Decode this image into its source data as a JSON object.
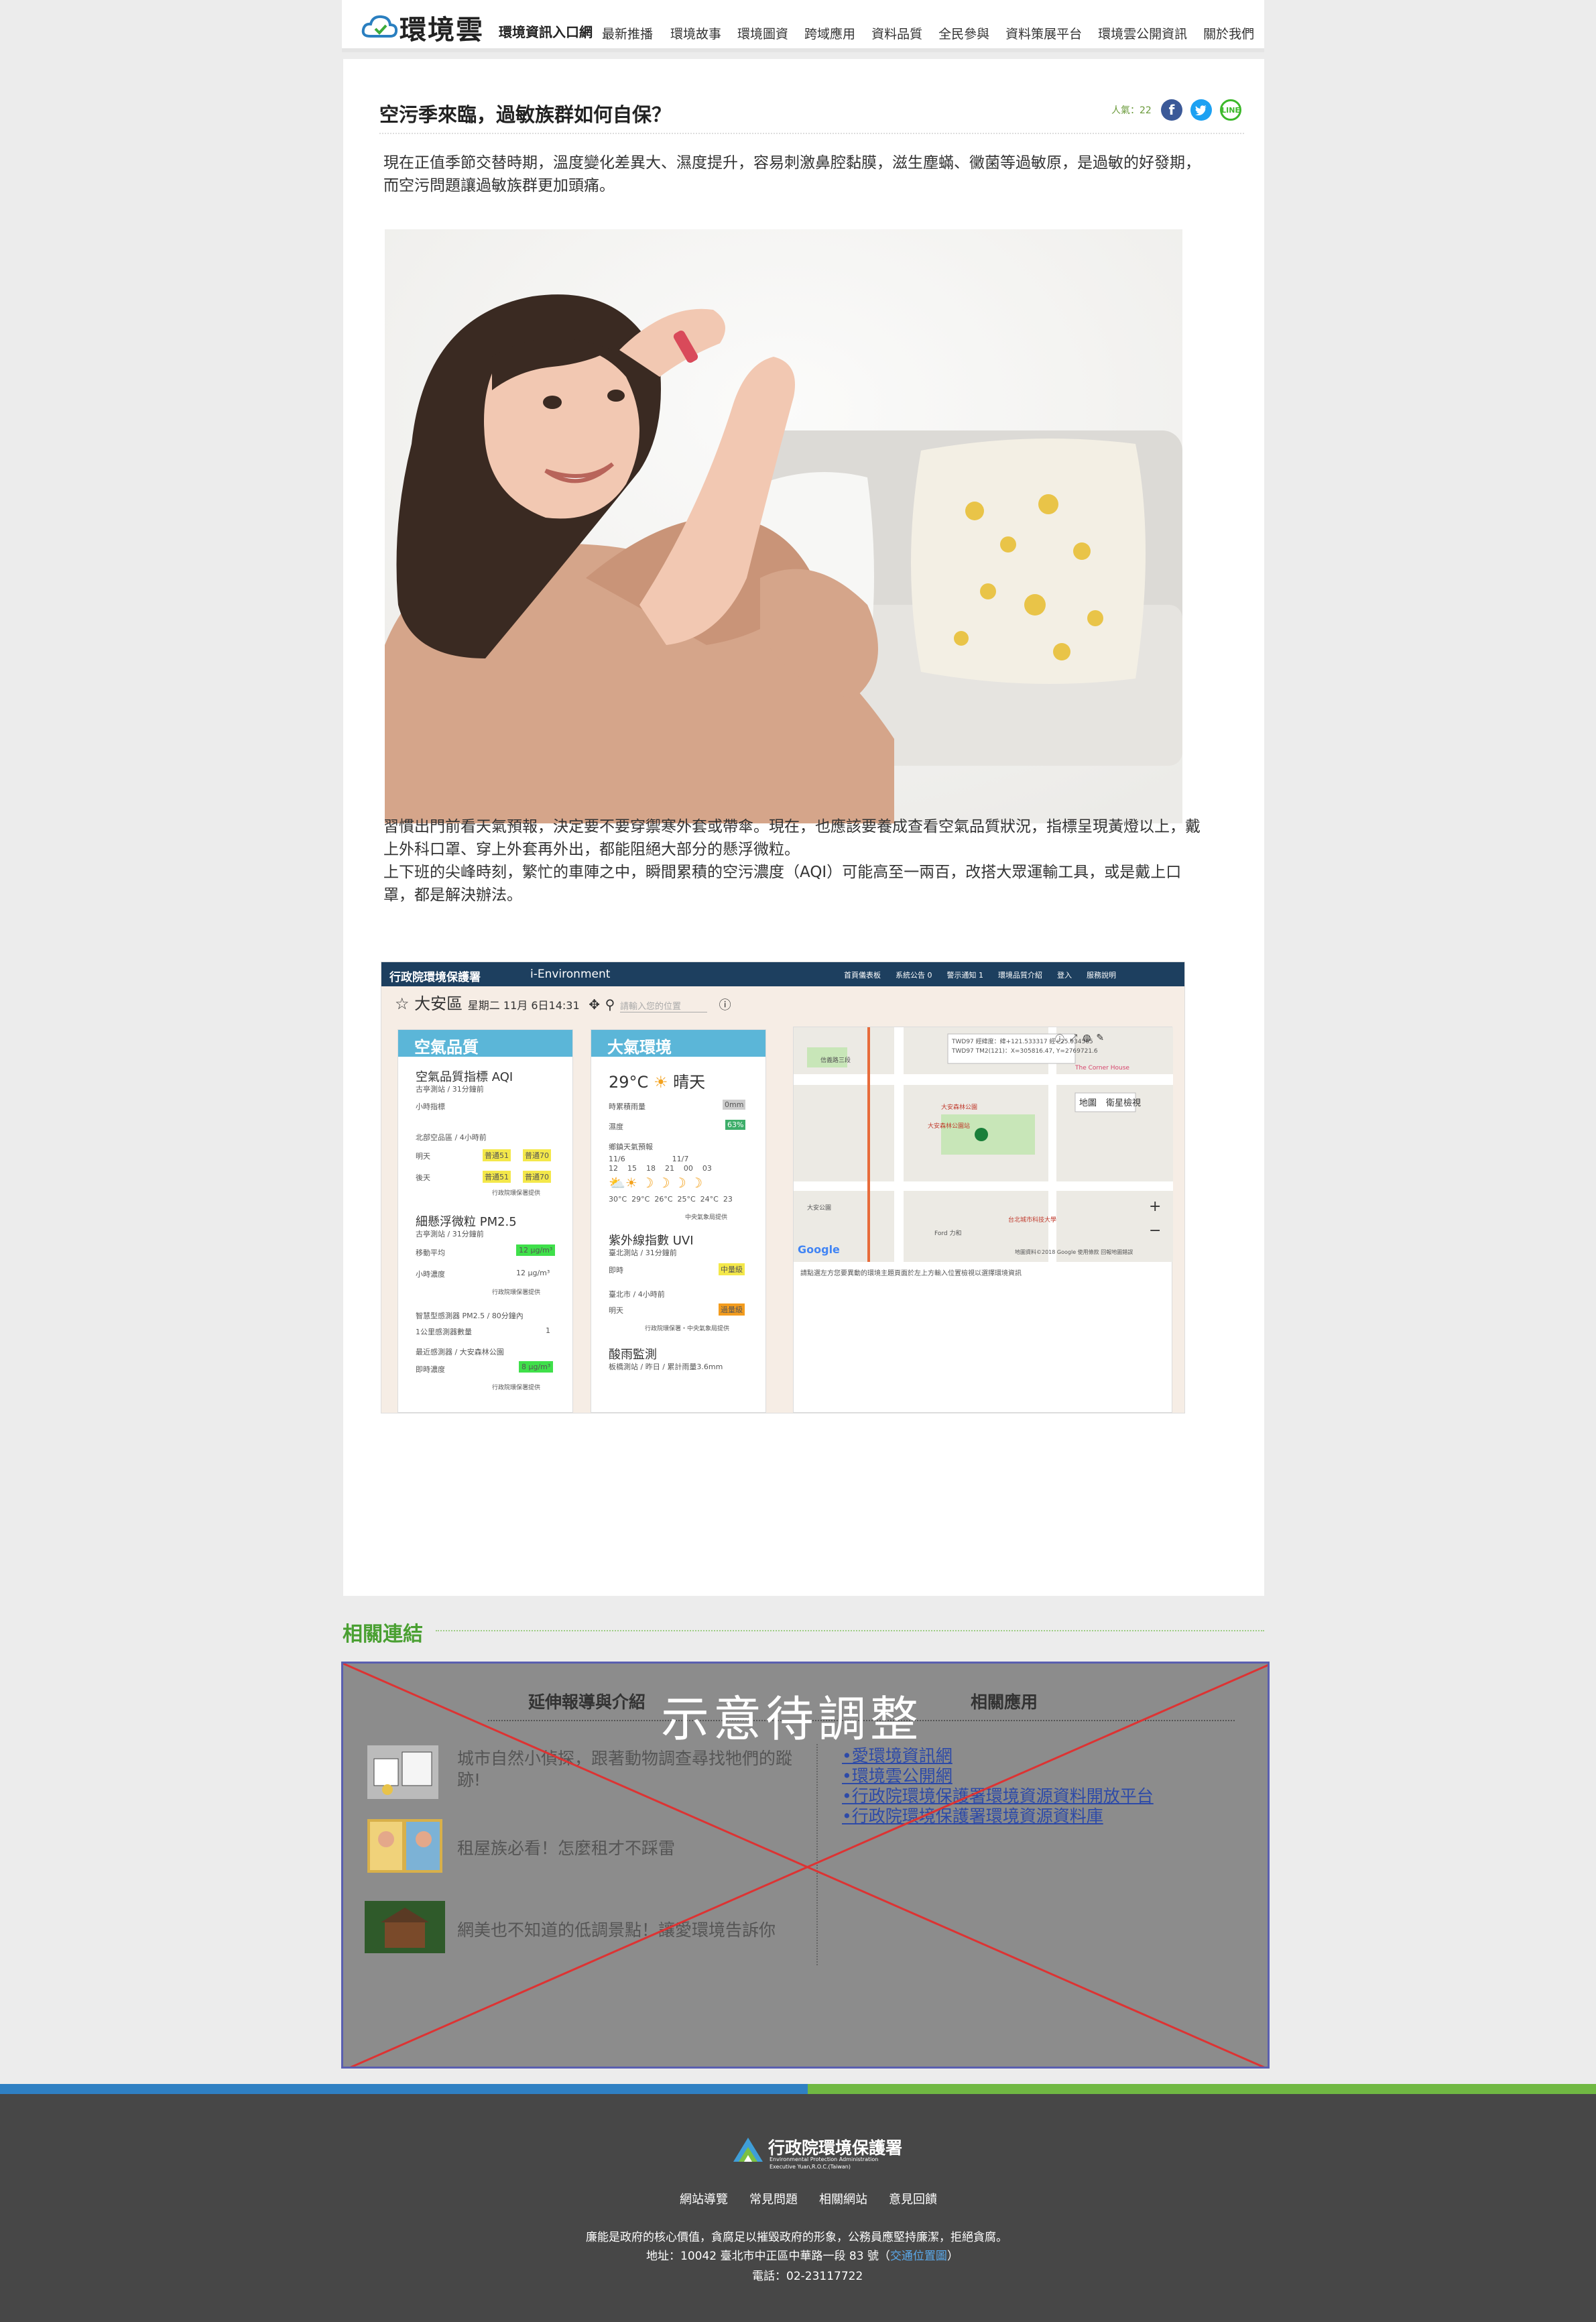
{
  "header": {
    "logo_text": "環境雲",
    "logo_subtitle": "環境資訊入口網",
    "nav": [
      "最新推播",
      "環境故事",
      "環境圖資",
      "跨域應用",
      "資料品質",
      "全民參與",
      "資料策展平台",
      "環境雲公開資訊",
      "關於我們"
    ]
  },
  "article": {
    "title": "空污季來臨，過敏族群如何自保？",
    "views": "人氣：22",
    "intro": "現在正值季節交替時期，溫度變化差異大、濕度提升，容易刺激鼻腔黏膜，滋生塵蟎、黴菌等過敏原，是過敏的好發期，而空污問題讓過敏族群更加頭痛。",
    "body1": "習慣出門前看天氣預報，決定要不要穿禦寒外套或帶傘。現在，也應該要養成查看空氣品質狀況，指標呈現黃燈以上，戴上外科口罩、穿上外套再外出，都能阻絕大部分的懸浮微粒。",
    "body2": "上下班的尖峰時刻，繁忙的車陣之中，瞬間累積的空污濃度（AQI）可能高至一兩百，改搭大眾運輸工具，或是戴上口罩，都是解決辦法。"
  },
  "screenshot": {
    "agency": "行政院環境保護署",
    "app": "i-Environment",
    "menu": [
      "首頁儀表板",
      "系統公告 0",
      "警示通知 1",
      "環境品質介紹",
      "登入",
      "服務說明"
    ],
    "location": "大安區",
    "date": "星期二 11月 6日14:31",
    "search_placeholder": "請輸入您的位置",
    "air_card": {
      "title": "空氣品質",
      "aqi_label": "空氣品質指標 AQI",
      "aqi_note": "古亭測站 / 31分鐘前",
      "hourly": "小時指標",
      "forecast_label": "北部空品區 / 4小時前",
      "tomorrow": "明天",
      "after": "後天",
      "badge1": "普通51",
      "badge2": "普通70",
      "source": "行政院環保署提供",
      "pm_label": "細懸浮微粒 PM2.5",
      "pm_note": "古亭測站 / 31分鐘前",
      "moving": "移動平均",
      "pm_val": "12 μg/m³",
      "hourly_conc": "小時濃度",
      "hourly_val": "12 μg/m³",
      "sensor": "智慧型感測器 PM2.5 / 80分鐘內",
      "sensor_count": "1公里感測器數量",
      "sensor_count_val": "1",
      "nearest": "最近感測器 / 大安森林公園",
      "nearest_label": "即時濃度",
      "nearest_val": "8 μg/m³"
    },
    "weather_card": {
      "title": "大氣環境",
      "temp": "29°C",
      "cond": "晴天",
      "rain": "時累積雨量",
      "rain_val": "0mm",
      "humidity": "濕度",
      "humidity_val": "63%",
      "forecast": "鄉鎮天氣預報",
      "dates": "11/6                    11/7",
      "hours": "12    15    18    21    00    03",
      "temps": "30°C  29°C  26°C  25°C  24°C  23",
      "source": "中央氣象局提供",
      "uvi_label": "紫外線指數 UVI",
      "uvi_note": "臺北測站 / 31分鐘前",
      "uvi_now": "即時",
      "uvi_val": "中量級",
      "uv_forecast": "臺北市 / 4小時前",
      "uv_tomorrow": "明天",
      "uv_tomorrow_val": "過量級",
      "uv_source": "行政院環保署・中央氣象局提供",
      "acid_label": "酸雨監測",
      "acid_note": "板橋測站 / 昨日 / 累計雨量3.6mm"
    },
    "map": {
      "layer_map": "地圖",
      "layer_sat": "衛星檢視",
      "popup1": "TWD97 經緯度：緯+121.533317 經+25.034565",
      "popup2": "TWD97 TM2(121)：X=305816.47, Y=2769721.6",
      "note": "請點選左方您要異動的環境主題頁面於左上方輸入位置檢視以選擇環境資訊",
      "copyright": "地圖資料©2018 Google   使用條款   回報地圖錯誤",
      "google": "Google",
      "places": [
        "信義路三段",
        "大安森林公園",
        "大安公園",
        "The Corner House",
        "大安森林公園站",
        "Ford 力和",
        "台北城市科技大學"
      ]
    }
  },
  "related": {
    "title": "相關連結",
    "left_header": "延伸報導與介紹",
    "right_header": "相關應用",
    "watermark": "示意待調整",
    "stories": [
      "城市自然小偵探，跟著動物調查尋找牠們的蹤跡!",
      "租屋族必看！怎麼租才不踩雷",
      "網美也不知道的低調景點！讓愛環境告訴你"
    ],
    "apps": [
      "•愛環境資訊網",
      "•環境雲公開網",
      "•行政院環境保護署環境資源資料開放平台",
      "•行政院環境保護署環境資源資料庫"
    ]
  },
  "footer": {
    "agency": "行政院環境保護署",
    "agency_en1": "Environmental Protection Administration",
    "agency_en2": "Executive Yuan,R.O.C.(Taiwan)",
    "links": [
      "網站導覽",
      "常見問題",
      "相關網站",
      "意見回饋"
    ],
    "slogan": "廉能是政府的核心價值，貪腐足以摧毀政府的形象，公務員應堅持廉潔，拒絕貪腐。",
    "address": "地址：10042 臺北市中正區中華路一段 83 號（",
    "map_link": "交通位置圖",
    "address_end": "）",
    "phone": "電話：02-23117722"
  },
  "colors": {
    "brand_green": "#4aa032",
    "link_blue": "#2d4aa8",
    "footer_bg": "#474747",
    "facebook": "#3b5998",
    "twitter": "#1da1f2",
    "line": "#3cb82a"
  }
}
